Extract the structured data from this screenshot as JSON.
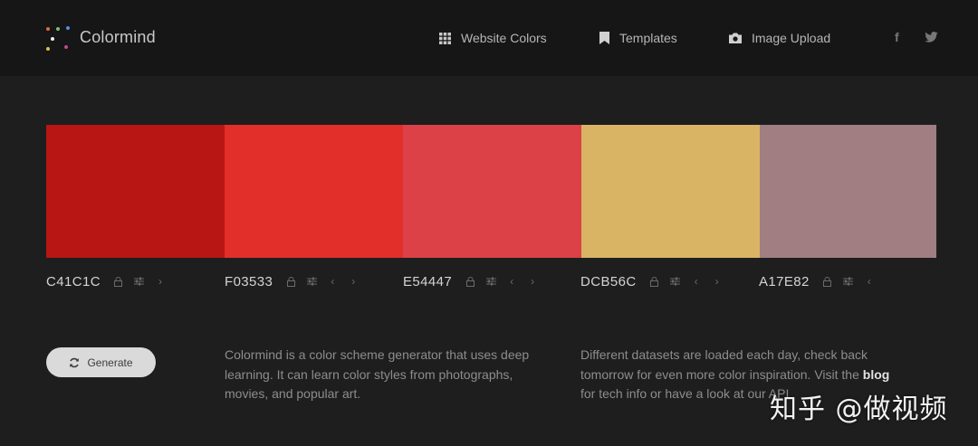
{
  "header": {
    "brand": "Colormind",
    "nav": [
      {
        "label": "Website Colors",
        "icon": "grid-icon"
      },
      {
        "label": "Templates",
        "icon": "bookmark-icon"
      },
      {
        "label": "Image Upload",
        "icon": "camera-icon"
      }
    ],
    "social": {
      "facebook": "f",
      "twitter": "twitter-icon"
    }
  },
  "palette": [
    {
      "hex": "C41C1C",
      "color": "#B81614"
    },
    {
      "hex": "F03533",
      "color": "#E32F2A"
    },
    {
      "hex": "E54447",
      "color": "#DB4147"
    },
    {
      "hex": "DCB56C",
      "color": "#D9B465"
    },
    {
      "hex": "A17E82",
      "color": "#A17E82"
    }
  ],
  "generate_label": "Generate",
  "description": "Colormind is a color scheme generator that uses deep learning. It can learn color styles from photographs, movies, and popular art.",
  "datasets_text": {
    "before": "Different datasets are loaded each day, check back tomorrow for even more color inspiration. Visit the ",
    "link": "blog",
    "after": " for tech info or have a look at our API"
  },
  "watermark": "知乎 @做视频"
}
